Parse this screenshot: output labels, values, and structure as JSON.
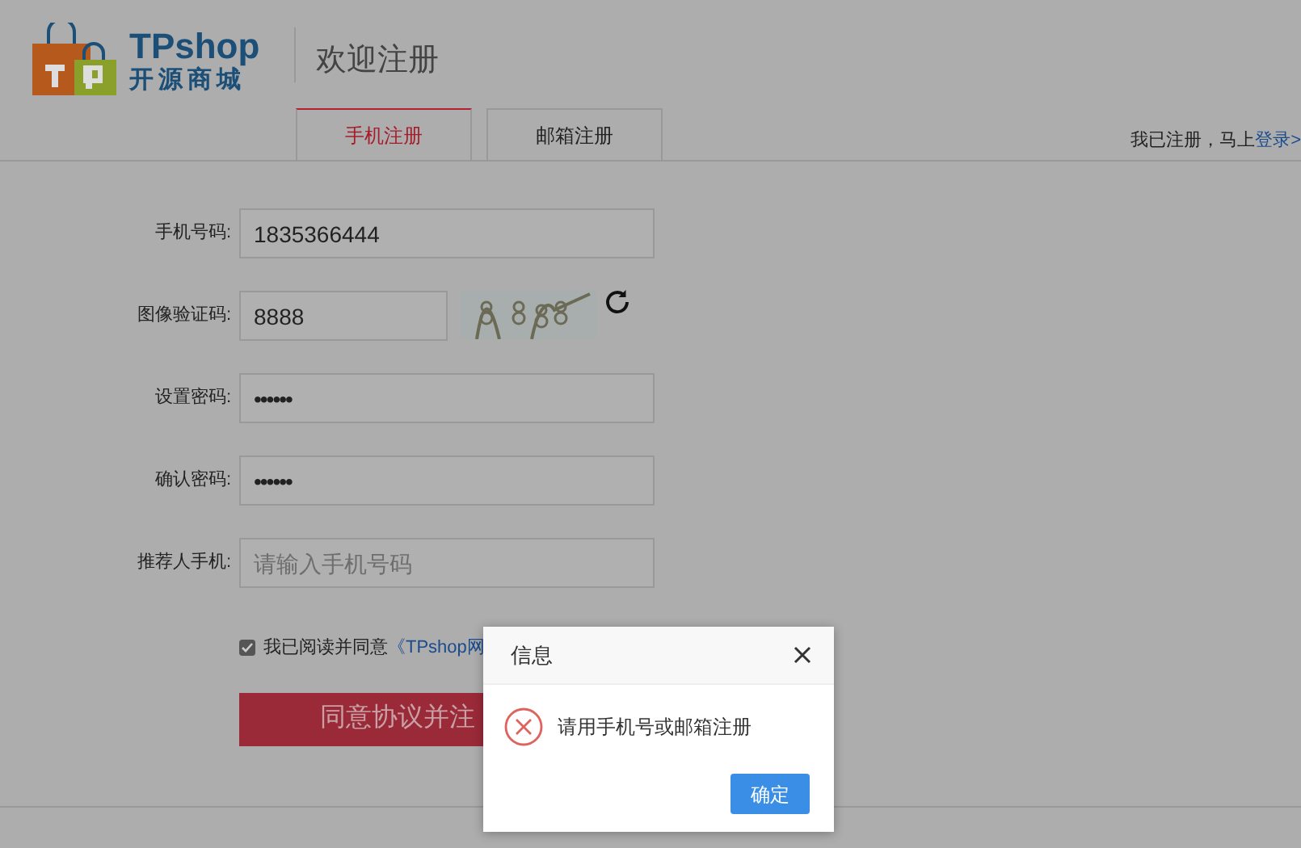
{
  "header": {
    "logo_top": "TPshop",
    "logo_bottom": "开源商城",
    "title": "欢迎注册"
  },
  "tabs": [
    {
      "label": "手机注册",
      "selected": true
    },
    {
      "label": "邮箱注册",
      "selected": false
    }
  ],
  "login_prompt": {
    "text": "我已注册，马上",
    "link": "登录>"
  },
  "form": [
    {
      "kind": "text",
      "label": "手机号码:",
      "value": "1835366444"
    },
    {
      "kind": "captcha",
      "label": "图像验证码:",
      "value": "8888"
    },
    {
      "kind": "password",
      "label": "设置密码:",
      "value": "••••••"
    },
    {
      "kind": "password",
      "label": "确认密码:",
      "value": "••••••"
    },
    {
      "kind": "text",
      "label": "推荐人手机:",
      "placeholder": "请输入手机号码"
    }
  ],
  "agreement": {
    "checked": true,
    "text": "我已阅读并同意",
    "link": "《TPshop网"
  },
  "submit_button": "同意协议并注",
  "dialog": {
    "title": "信息",
    "message": "请用手机号或邮箱注册",
    "button": "确定"
  }
}
